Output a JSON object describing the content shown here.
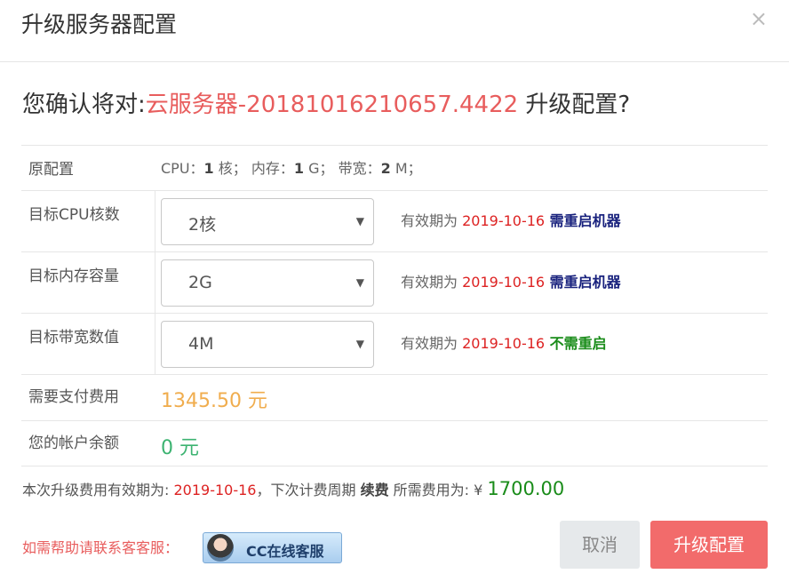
{
  "dialog": {
    "title": "升级服务器配置",
    "close_label": "×"
  },
  "question": {
    "prefix": "您确认将对:",
    "server_name": "云服务器-20181016210657.4422",
    "suffix": " 升级配置?"
  },
  "original": {
    "label": "原配置",
    "cpu_label": "CPU：",
    "cpu_value": "1",
    "cpu_unit": " 核；  内存：",
    "mem_value": "1",
    "mem_unit": " G；  带宽：",
    "bw_value": "2",
    "bw_unit": " M；"
  },
  "cpu_row": {
    "label": "目标CPU核数",
    "selected": "2核",
    "note_prefix": "有效期为 ",
    "date": "2019-10-16",
    "note_suffix": " 需重启机器"
  },
  "mem_row": {
    "label": "目标内存容量",
    "selected": "2G",
    "note_prefix": "有效期为 ",
    "date": "2019-10-16",
    "note_suffix": " 需重启机器"
  },
  "bw_row": {
    "label": "目标带宽数值",
    "selected": "4M",
    "note_prefix": "有效期为 ",
    "date": "2019-10-16",
    "note_suffix": " 不需重启"
  },
  "payment": {
    "label": "需要支付费用",
    "value": "1345.50 元"
  },
  "balance": {
    "label": "您的帐户余额",
    "value": "0 元"
  },
  "summary": {
    "prefix": "本次升级费用有效期为: ",
    "date": "2019-10-16",
    "mid": "，下次计费周期 ",
    "renew": "续费",
    "fee_label": " 所需费用为: ¥ ",
    "amount": "1700.00"
  },
  "help": {
    "text": "如需帮助请联系客客服：",
    "cc_button": "CC在线客服"
  },
  "buttons": {
    "cancel": "取消",
    "upgrade": "升级配置"
  },
  "colors": {
    "accent": "#f26b6b",
    "highlight_red": "#e85d5d",
    "pay_orange": "#f0ad4e",
    "balance_green": "#3cb371"
  }
}
